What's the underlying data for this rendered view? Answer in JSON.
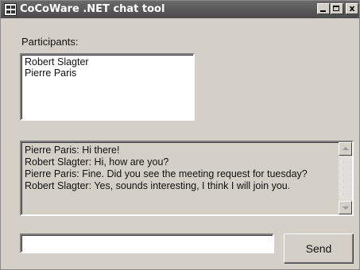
{
  "window": {
    "title": "CoCoWare .NET chat tool",
    "icon": "app-icon",
    "controls": [
      "minimize-icon",
      "maximize-icon",
      "close-icon"
    ],
    "close_label": "x"
  },
  "participants": {
    "label": "Participants:",
    "items": [
      "Robert Slagter",
      "Pierre Paris"
    ]
  },
  "chat": {
    "messages": [
      "Pierre Paris: Hi there!",
      "Robert Slagter: Hi, how are you?",
      "Pierre Paris: Fine. Did you see the meeting request for tuesday?",
      "Robert Slagter: Yes, sounds interesting, I think I will join you."
    ]
  },
  "composer": {
    "input_value": "",
    "send_label": "Send"
  },
  "colors": {
    "window_bg": "#d4d0c8",
    "titlebar_bg": "#4a4a4a",
    "title_text": "#ffffff"
  }
}
